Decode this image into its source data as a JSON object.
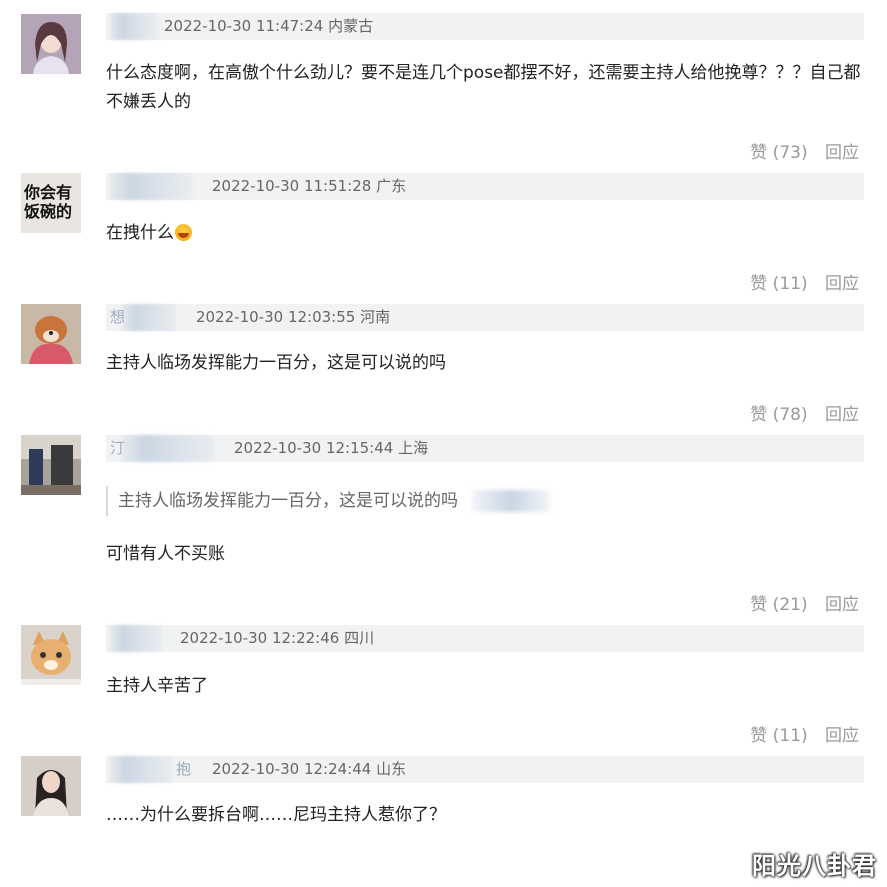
{
  "top_fragment": "· ·",
  "comments": [
    {
      "timestamp": "2022-10-30 11:47:24",
      "location": "内蒙古",
      "text": "什么态度啊，在高傲个什么劲儿？要不是连几个pose都摆不好，还需要主持人给他挽尊？？？自己都不嫌丢人的",
      "like_label": "赞 (73)",
      "reply_label": "回应",
      "avatar": "avatar-girl-portrait"
    },
    {
      "timestamp": "2022-10-30 11:51:28",
      "location": "广东",
      "text": "在拽什么",
      "emoji": "grinning-face-emoji",
      "like_label": "赞 (11)",
      "reply_label": "回应",
      "avatar": "avatar-text-image",
      "avatar_text_line1": "你会有",
      "avatar_text_line2": "饭碗的"
    },
    {
      "username_fragment": "想",
      "timestamp": "2022-10-30 12:03:55",
      "location": "河南",
      "text": "主持人临场发挥能力一百分，这是可以说的吗",
      "like_label": "赞 (78)",
      "reply_label": "回应",
      "avatar": "avatar-dog-photo"
    },
    {
      "username_fragment": "汀",
      "timestamp": "2022-10-30 12:15:44",
      "location": "上海",
      "quote": "主持人临场发挥能力一百分，这是可以说的吗",
      "text": "可惜有人不买账",
      "like_label": "赞 (21)",
      "reply_label": "回应",
      "avatar": "avatar-room-photo"
    },
    {
      "timestamp": "2022-10-30 12:22:46",
      "location": "四川",
      "text": "主持人辛苦了",
      "like_label": "赞 (11)",
      "reply_label": "回应",
      "avatar": "avatar-cat-photo"
    },
    {
      "username_fragment": "抱",
      "timestamp": "2022-10-30 12:24:44",
      "location": "山东",
      "text": "……为什么要拆台啊……尼玛主持人惹你了？",
      "avatar": "avatar-selfie-photo"
    }
  ],
  "watermark": "阳光八卦君"
}
